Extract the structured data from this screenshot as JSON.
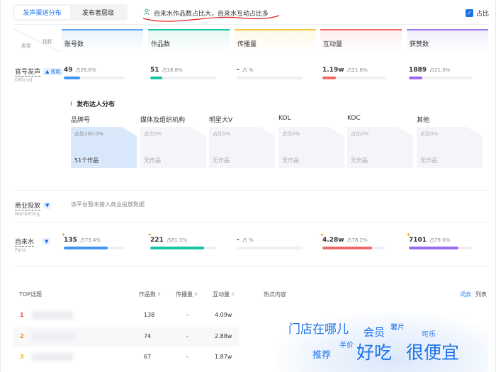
{
  "tabs": [
    {
      "label": "发声渠道分布",
      "active": true
    },
    {
      "label": "发布者层级",
      "active": false
    }
  ],
  "insight": "自来水作品数占比大，自来水互动占比多",
  "ratio_toggle": {
    "label": "占比",
    "checked": true
  },
  "header": {
    "diag_top": "指标",
    "diag_bottom": "类型"
  },
  "columns": [
    {
      "label": "账号数",
      "color": "#5aa2f5"
    },
    {
      "label": "作品数",
      "color": "#15c4a5"
    },
    {
      "label": "传播量",
      "color": "#f5c542"
    },
    {
      "label": "互动量",
      "color": "#f06a6a"
    },
    {
      "label": "获赞数",
      "color": "#9b7bf0"
    }
  ],
  "official": {
    "label": "官号发声",
    "sub": "Official",
    "pill": "▲ 收起",
    "metrics": [
      {
        "value": "49",
        "pct": "占26.6%",
        "fill": 0.266,
        "color": "#3e97f5"
      },
      {
        "value": "51",
        "pct": "占18.8%",
        "fill": 0.188,
        "color": "#15c4a5"
      },
      {
        "value": "-",
        "pct": "占 %",
        "fill": 0,
        "color": "#f5c542"
      },
      {
        "value": "1.19w",
        "pct": "占21.8%",
        "fill": 0.218,
        "color": "#f06a6a"
      },
      {
        "value": "1889",
        "pct": "占21.0%",
        "fill": 0.21,
        "color": "#9b6bf0"
      }
    ]
  },
  "distribution": {
    "title": "发布达人分布",
    "cards": [
      {
        "label": "品牌号",
        "pct": "占比100.0%",
        "works": "51个作品",
        "active": true
      },
      {
        "label": "媒体及组织机构",
        "pct": "占比0%",
        "works": "无作品",
        "active": false
      },
      {
        "label": "明星大V",
        "pct": "占比0%",
        "works": "无作品",
        "active": false
      },
      {
        "label": "KOL",
        "pct": "占比0%",
        "works": "无作品",
        "active": false
      },
      {
        "label": "KOC",
        "pct": "占比0%",
        "works": "无作品",
        "active": false
      },
      {
        "label": "其他",
        "pct": "占比0%",
        "works": "无作品",
        "active": false
      }
    ]
  },
  "business": {
    "label": "商业投放",
    "sub": "Marketing",
    "note": "该平台暂未接入商业投放数据"
  },
  "fans": {
    "label": "自来水",
    "sub": "Fans",
    "metrics": [
      {
        "value": "135",
        "pct": "占73.4%",
        "fill": 0.734,
        "color": "#3e97f5",
        "spark": true
      },
      {
        "value": "221",
        "pct": "占81.3%",
        "fill": 0.813,
        "color": "#15c4a5",
        "spark": true
      },
      {
        "value": "-",
        "pct": "占 %",
        "fill": 0,
        "color": "#f5c542",
        "spark": false
      },
      {
        "value": "4.28w",
        "pct": "占78.2%",
        "fill": 0.782,
        "color": "#f06a6a",
        "spark": true
      },
      {
        "value": "7101",
        "pct": "占79.0%",
        "fill": 0.79,
        "color": "#9b6bf0",
        "spark": true
      }
    ]
  },
  "topics": {
    "title": "TOP话题",
    "headers": [
      "作品数",
      "传播量",
      "互动量"
    ],
    "rows": [
      {
        "rank": "1",
        "rank_color": "#f04848",
        "works": "138",
        "spread": "-",
        "interact": "4.09w"
      },
      {
        "rank": "2",
        "rank_color": "#f5891f",
        "works": "74",
        "spread": "-",
        "interact": "2.88w"
      },
      {
        "rank": "3",
        "rank_color": "#f5b51f",
        "works": "67",
        "spread": "-",
        "interact": "1.87w"
      }
    ]
  },
  "hot": {
    "title": "热点内容",
    "view_tabs": [
      "词云",
      "列表"
    ],
    "words": [
      {
        "text": "门店在哪儿",
        "size": 17
      },
      {
        "text": "会员",
        "size": 15
      },
      {
        "text": "薯片",
        "size": 10
      },
      {
        "text": "可乐",
        "size": 10
      },
      {
        "text": "推荐",
        "size": 13
      },
      {
        "text": "半价",
        "size": 10
      },
      {
        "text": "好吃",
        "size": 25
      },
      {
        "text": "很便宜",
        "size": 25
      }
    ]
  }
}
